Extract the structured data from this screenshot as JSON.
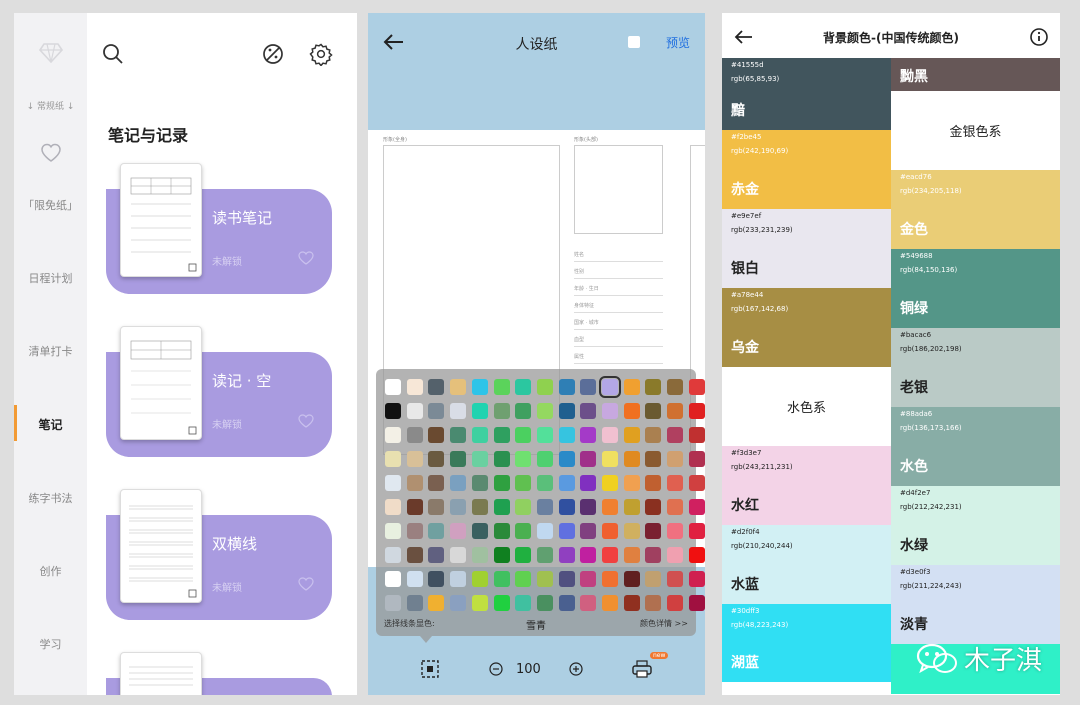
{
  "sidebar": {
    "tag": "↓ 常规纸 ↓",
    "items": [
      "「限免纸」",
      "日程计划",
      "清单打卡",
      "笔记",
      "练字书法",
      "创作",
      "学习"
    ],
    "active_index": 3
  },
  "notebook": {
    "section_title": "笔记与记录",
    "cards": [
      {
        "title": "读书笔记",
        "status": "未解锁"
      },
      {
        "title": "读记 · 空",
        "status": "未解锁"
      },
      {
        "title": "双横线",
        "status": "未解锁"
      }
    ]
  },
  "editor": {
    "title": "人设纸",
    "preview_label": "预览",
    "sheet_labels": {
      "left": "形象(全身)",
      "right": "形象(头部)"
    },
    "field_labels": [
      "姓名",
      "性别",
      "年龄 · 生日",
      "身体特征",
      "国家 · 城市",
      "血型",
      "属性"
    ],
    "palette_hint": "选择线条显色:",
    "selected_color_name": "雪青",
    "color_detail_link": "颜色详情 >>",
    "zoom_value": "100",
    "print_badge": "new",
    "palette_colors": [
      [
        "#ffffff",
        "#f7e7d7",
        "#54616b",
        "#e5c07b",
        "#2ec4e8",
        "#5bd35b",
        "#2bc7a0",
        "#8fd14f",
        "#2f7fb5",
        "#5b6e99",
        "#b3a7e6",
        "#f0a030",
        "#8a7a2a",
        "#8a6a3a",
        "#e03a3a"
      ],
      [
        "#111111",
        "#e8e8e8",
        "#7b8a96",
        "#d9dde6",
        "#20d3b0",
        "#6fa070",
        "#3fa060",
        "#94d860",
        "#1f5f8f",
        "#6c4f8a",
        "#c7a8e0",
        "#f07020",
        "#6a5a30",
        "#d07030",
        "#e02020"
      ],
      [
        "#f3f0e6",
        "#8a8a8a",
        "#6a4a30",
        "#4a8a70",
        "#3fd0a0",
        "#2fa060",
        "#4bd060",
        "#53e09a",
        "#36c4e0",
        "#a43ac8",
        "#f0c0d0",
        "#e0a020",
        "#aa8050",
        "#b04060",
        "#c03030"
      ],
      [
        "#e8e0b0",
        "#d8c098",
        "#6a5a40",
        "#3a7a5a",
        "#6ad0a0",
        "#2a9050",
        "#6fe070",
        "#4fd070",
        "#2a8ac8",
        "#a0308a",
        "#f0e060",
        "#e08a20",
        "#8a5a30",
        "#d0a070",
        "#b03050"
      ],
      [
        "#e0e8f0",
        "#b09070",
        "#7a6050",
        "#7aa0c0",
        "#5a8a70",
        "#2fa040",
        "#60c050",
        "#5abf7a",
        "#5a9ae0",
        "#8030c0",
        "#f0d020",
        "#f0a050",
        "#c06030",
        "#e06050",
        "#d04040"
      ],
      [
        "#f0dcc8",
        "#6a3a2a",
        "#8a7a6a",
        "#8aa0b0",
        "#7a7a50",
        "#1fa050",
        "#90d060",
        "#6a80a0",
        "#3050a0",
        "#5a3070",
        "#f08030",
        "#c0a030",
        "#8a3020",
        "#e07050",
        "#d02060"
      ],
      [
        "#e8f0e0",
        "#9a8080",
        "#70a0a0",
        "#d0a0c0",
        "#3a6060",
        "#2a8a3a",
        "#4ab050",
        "#c0d8f0",
        "#6070e0",
        "#804080",
        "#f06030",
        "#d0b060",
        "#7a2030",
        "#f07080",
        "#e02040"
      ],
      [
        "#d0d8e0",
        "#6a5040",
        "#606080",
        "#d8d8d8",
        "#a0c0a0",
        "#108020",
        "#20b040",
        "#60a070",
        "#9040c0",
        "#c020a0",
        "#f04040",
        "#e08040",
        "#a04060",
        "#f0a0b0",
        "#f01010"
      ],
      [
        "#ffffff",
        "#d0e0f0",
        "#405060",
        "#c0d0e0",
        "#a0d030",
        "#40c060",
        "#60d050",
        "#a0c050",
        "#505080",
        "#c04080",
        "#f07030",
        "#602020",
        "#c0a070",
        "#d05050",
        "#d02050"
      ],
      [
        "#b0b8c0",
        "#708090",
        "#f0b030",
        "#8aa0c0",
        "#c0e040",
        "#20d040",
        "#40c0a0",
        "#4a9060",
        "#4a6090",
        "#d06080",
        "#f09030",
        "#903020",
        "#b07050",
        "#d04040",
        "#a01040"
      ]
    ]
  },
  "color_page": {
    "title": "背景颜色-(中国传统颜色)",
    "left_column": [
      {
        "type": "color",
        "hex": "#41555d",
        "rgb": "rgb(65,85,93)",
        "name": "黯",
        "bg": "#41555d",
        "fg": "#ffffff"
      },
      {
        "type": "color",
        "hex": "#f2be45",
        "rgb": "rgb(242,190,69)",
        "name": "赤金",
        "bg": "#f2be45",
        "fg": "#ffffff"
      },
      {
        "type": "color",
        "hex": "#e9e7ef",
        "rgb": "rgb(233,231,239)",
        "name": "银白",
        "bg": "#e9e7ef",
        "fg": "#222222"
      },
      {
        "type": "color",
        "hex": "#a78e44",
        "rgb": "rgb(167,142,68)",
        "name": "乌金",
        "bg": "#a78e44",
        "fg": "#ffffff"
      },
      {
        "type": "section",
        "name": "水色系"
      },
      {
        "type": "color",
        "hex": "#f3d3e7",
        "rgb": "rgb(243,211,231)",
        "name": "水红",
        "bg": "#f3d3e7",
        "fg": "#222222"
      },
      {
        "type": "color",
        "hex": "#d2f0f4",
        "rgb": "rgb(210,240,244)",
        "name": "水蓝",
        "bg": "#d2f0f4",
        "fg": "#222222"
      },
      {
        "type": "color",
        "hex": "#30dff3",
        "rgb": "rgb(48,223,243)",
        "name": "湖蓝",
        "bg": "#30dff3",
        "fg": "#ffffff"
      }
    ],
    "right_column": [
      {
        "type": "color",
        "hex": "",
        "rgb": "",
        "name": "黝黑",
        "bg": "#665757",
        "fg": "#ffffff"
      },
      {
        "type": "section",
        "name": "金银色系"
      },
      {
        "type": "color",
        "hex": "#eacd76",
        "rgb": "rgb(234,205,118)",
        "name": "金色",
        "bg": "#eacd76",
        "fg": "#ffffff"
      },
      {
        "type": "color",
        "hex": "#549688",
        "rgb": "rgb(84,150,136)",
        "name": "铜绿",
        "bg": "#549688",
        "fg": "#ffffff"
      },
      {
        "type": "color",
        "hex": "#bacac6",
        "rgb": "rgb(186,202,198)",
        "name": "老银",
        "bg": "#bacac6",
        "fg": "#222222"
      },
      {
        "type": "color",
        "hex": "#88ada6",
        "rgb": "rgb(136,173,166)",
        "name": "水色",
        "bg": "#88ada6",
        "fg": "#ffffff"
      },
      {
        "type": "color",
        "hex": "#d4f2e7",
        "rgb": "rgb(212,242,231)",
        "name": "水绿",
        "bg": "#d4f2e7",
        "fg": "#222222"
      },
      {
        "type": "color",
        "hex": "#d3e0f3",
        "rgb": "rgb(211,224,243)",
        "name": "淡青",
        "bg": "#d3e0f3",
        "fg": "#222222"
      },
      {
        "type": "color",
        "hex": "",
        "rgb": "",
        "name": "",
        "bg": "#2ff0c8",
        "fg": "#ffffff"
      }
    ]
  },
  "watermark": {
    "text": "木子淇"
  },
  "icons": [
    "diamond-icon",
    "heart-icon",
    "search-icon",
    "palette-icon",
    "gear-icon",
    "back-icon",
    "checkbox-icon",
    "frame-select-icon",
    "zoom-out-icon",
    "zoom-in-icon",
    "print-icon",
    "info-icon",
    "wechat-icon"
  ]
}
